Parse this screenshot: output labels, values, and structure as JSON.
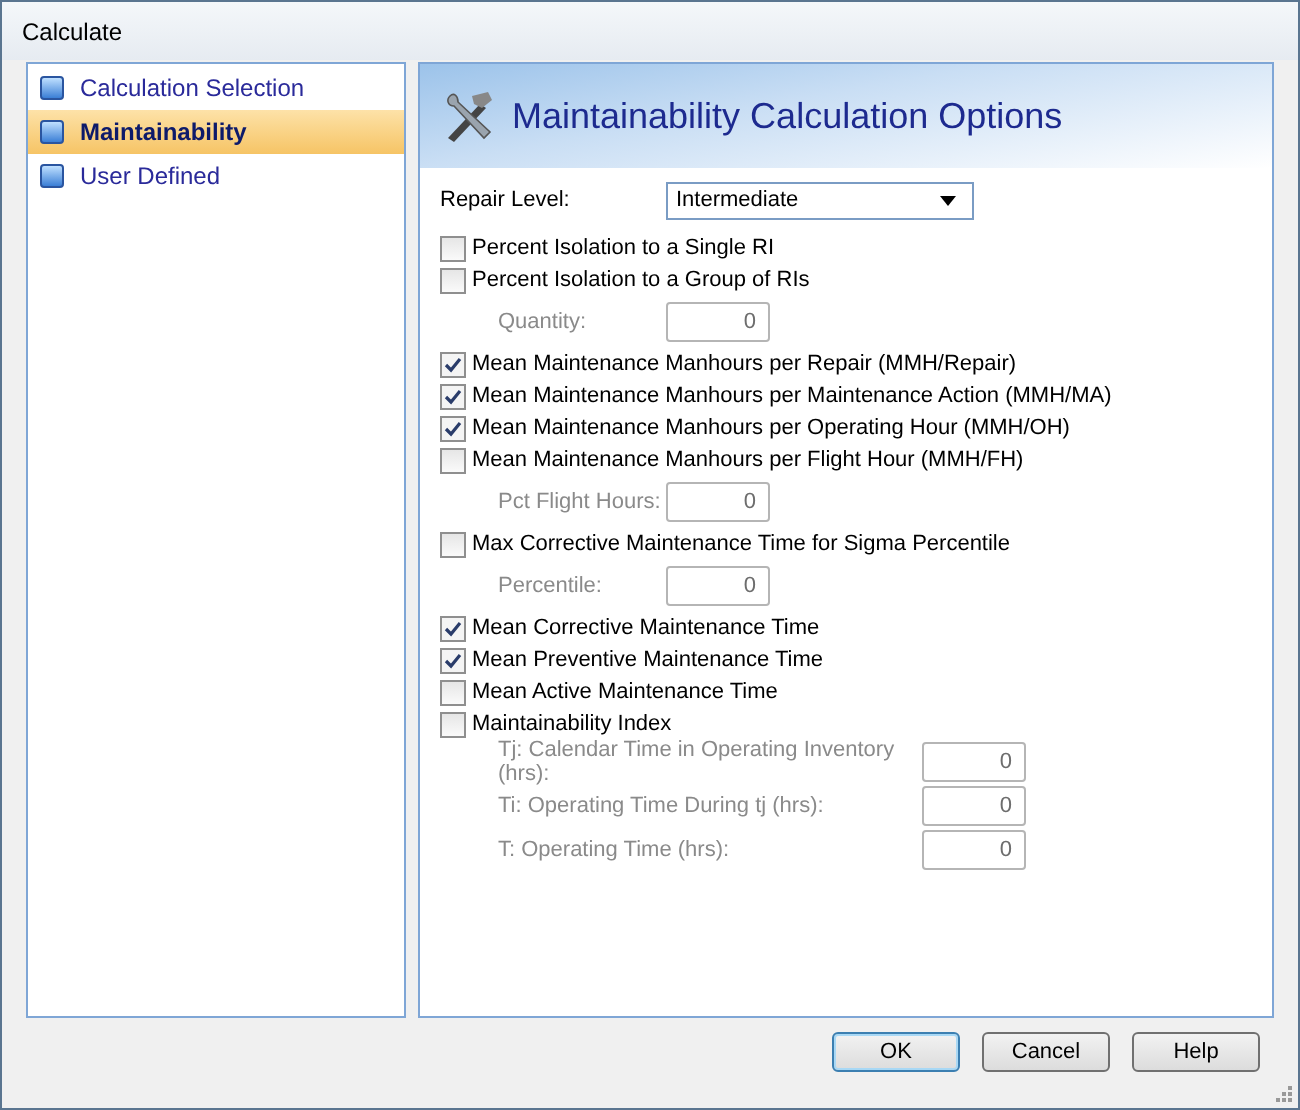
{
  "window": {
    "title": "Calculate"
  },
  "nav": [
    {
      "label": "Calculation Selection",
      "selected": false
    },
    {
      "label": "Maintainability",
      "selected": true
    },
    {
      "label": "User Defined",
      "selected": false
    }
  ],
  "panel": {
    "title": "Maintainability Calculation Options",
    "repair_level": {
      "label": "Repair Level:",
      "value": "Intermediate"
    },
    "options": [
      {
        "kind": "checkbox",
        "label": "Percent Isolation to a Single RI",
        "checked": false
      },
      {
        "kind": "checkbox",
        "label": "Percent Isolation to a Group of RIs",
        "checked": false
      },
      {
        "kind": "field",
        "label": "Quantity:",
        "value": "0",
        "disabled": true
      },
      {
        "kind": "checkbox",
        "label": "Mean Maintenance Manhours per Repair (MMH/Repair)",
        "checked": true
      },
      {
        "kind": "checkbox",
        "label": "Mean Maintenance Manhours per Maintenance Action (MMH/MA)",
        "checked": true
      },
      {
        "kind": "checkbox",
        "label": "Mean Maintenance Manhours per Operating Hour (MMH/OH)",
        "checked": true
      },
      {
        "kind": "checkbox",
        "label": "Mean Maintenance Manhours per Flight Hour (MMH/FH)",
        "checked": false
      },
      {
        "kind": "field",
        "label": "Pct Flight Hours:",
        "value": "0",
        "disabled": true
      },
      {
        "kind": "checkbox",
        "label": "Max Corrective Maintenance Time for Sigma Percentile",
        "checked": false
      },
      {
        "kind": "field",
        "label": "Percentile:",
        "value": "0",
        "disabled": true
      },
      {
        "kind": "checkbox",
        "label": "Mean Corrective Maintenance Time",
        "checked": true
      },
      {
        "kind": "checkbox",
        "label": "Mean Preventive Maintenance Time",
        "checked": true
      },
      {
        "kind": "checkbox",
        "label": "Mean Active Maintenance Time",
        "checked": false
      },
      {
        "kind": "checkbox",
        "label": "Maintainability Index",
        "checked": false
      },
      {
        "kind": "wide_field",
        "label": "Tj: Calendar Time in Operating Inventory (hrs):",
        "value": "0",
        "disabled": true
      },
      {
        "kind": "wide_field",
        "label": "Ti: Operating Time During tj (hrs):",
        "value": "0",
        "disabled": true
      },
      {
        "kind": "wide_field",
        "label": "T: Operating Time (hrs):",
        "value": "0",
        "disabled": true
      }
    ]
  },
  "buttons": [
    {
      "label": "OK",
      "default": true
    },
    {
      "label": "Cancel",
      "default": false
    },
    {
      "label": "Help",
      "default": false
    }
  ]
}
